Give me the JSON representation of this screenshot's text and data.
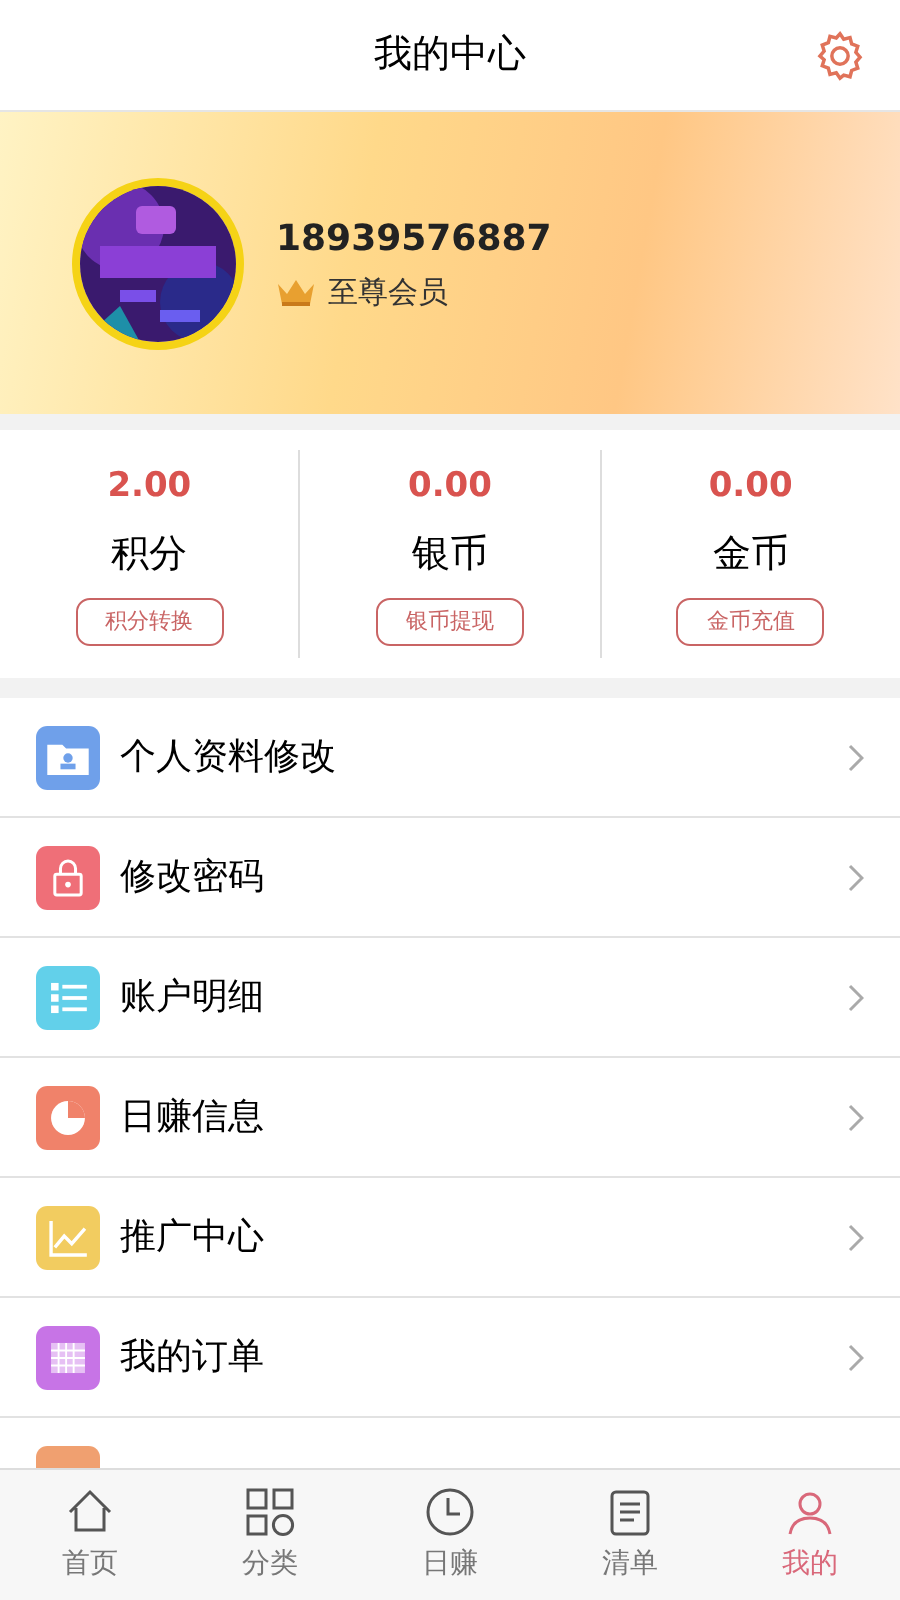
{
  "header": {
    "title": "我的中心"
  },
  "profile": {
    "phone": "18939576887",
    "member_level": "至尊会员"
  },
  "stats": [
    {
      "value": "2.00",
      "label": "积分",
      "action": "积分转换"
    },
    {
      "value": "0.00",
      "label": "银币",
      "action": "银币提现"
    },
    {
      "value": "0.00",
      "label": "金币",
      "action": "金币充值"
    }
  ],
  "menu": [
    {
      "kind": "folder",
      "label": "个人资料修改",
      "color": "#6fa0ea"
    },
    {
      "kind": "lock",
      "label": "修改密码",
      "color": "#ef6f78"
    },
    {
      "kind": "list",
      "label": "账户明细",
      "color": "#62d0ea"
    },
    {
      "kind": "pie",
      "label": "日赚信息",
      "color": "#f0826a"
    },
    {
      "kind": "chart",
      "label": "推广中心",
      "color": "#f2cc60"
    },
    {
      "kind": "grid",
      "label": "我的订单",
      "color": "#c774e6"
    },
    {
      "kind": "partial",
      "color": "#f0a070"
    }
  ],
  "tabs": [
    {
      "kind": "home",
      "label": "首页",
      "selected": false
    },
    {
      "kind": "grid",
      "label": "分类",
      "selected": false
    },
    {
      "kind": "clock",
      "label": "日赚",
      "selected": false
    },
    {
      "kind": "list",
      "label": "清单",
      "selected": false
    },
    {
      "kind": "user",
      "label": "我的",
      "selected": true
    }
  ]
}
